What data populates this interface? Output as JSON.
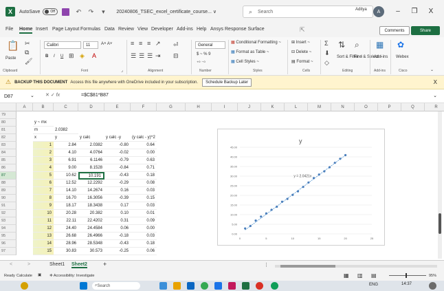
{
  "titlebar": {
    "autosave_label": "AutoSave",
    "autosave_state": "Off",
    "filename": "20240806_TSEC_excel_certificate_course... ∨",
    "search_placeholder": "Search",
    "user_name": "Aditya",
    "avatar_initial": "A",
    "minimize": "–",
    "restore": "❐",
    "close": "X"
  },
  "menu": {
    "items": [
      "File",
      "Home",
      "Insert",
      "Page Layout",
      "Formulas",
      "Data",
      "Review",
      "View",
      "Developer",
      "Add-ins",
      "Help",
      "Ansys Response Surface"
    ],
    "active": "Home",
    "comments_label": "Comments",
    "share_label": "Share"
  },
  "ribbon": {
    "groups": [
      "Clipboard",
      "Font",
      "Alignment",
      "Number",
      "Styles",
      "Cells",
      "Editing",
      "Add-ins",
      "Cisco"
    ],
    "paste_label": "Paste",
    "font_name": "Calibri",
    "font_size": "11",
    "number_format": "General",
    "styles": [
      "Conditional Formatting ~",
      "Format as Table ~",
      "Cell Styles ~"
    ],
    "cells": [
      "Insert ~",
      "Delete ~",
      "Format ~"
    ],
    "editing": [
      "Sort & Filter ~",
      "Find & Select ~"
    ],
    "addins_label": "Add-ins",
    "webex_label": "Webex"
  },
  "notification": {
    "title": "BACKUP THIS DOCUMENT",
    "message": "Access this file anywhere with OneDrive included in your subscription.",
    "button": "Schedule Backup Later",
    "close": "X"
  },
  "formula_bar": {
    "name_box": "D87",
    "fx": "fx",
    "formula": "=$C$81*B87"
  },
  "grid": {
    "columns": [
      "A",
      "B",
      "C",
      "D",
      "E",
      "F",
      "G",
      "H",
      "I",
      "J",
      "K",
      "L",
      "M",
      "N",
      "O",
      "P",
      "Q",
      "R"
    ],
    "rows": [
      "79",
      "80",
      "81",
      "82",
      "83",
      "84",
      "85",
      "86",
      "87",
      "88",
      "89",
      "90",
      "91",
      "92",
      "93",
      "94",
      "95",
      "96",
      "97"
    ],
    "selected_row": "87",
    "label_y_mx": "y ~ mx",
    "label_m": "m",
    "m_value": "2.0382",
    "headers": [
      "x",
      "y",
      "y calc",
      "y calc -y",
      "(y calc - y)^2"
    ],
    "data": [
      [
        "1",
        "2.84",
        "2.0382",
        "-0.80",
        "0.64"
      ],
      [
        "2",
        "4.10",
        "4.0764",
        "-0.02",
        "0.00"
      ],
      [
        "3",
        "6.91",
        "6.1146",
        "-0.79",
        "0.63"
      ],
      [
        "4",
        "9.00",
        "8.1528",
        "-0.84",
        "0.71"
      ],
      [
        "5",
        "10.62",
        "10.191",
        "-0.43",
        "0.18"
      ],
      [
        "6",
        "12.52",
        "12.2292",
        "-0.29",
        "0.08"
      ],
      [
        "7",
        "14.10",
        "14.2674",
        "0.16",
        "0.03"
      ],
      [
        "8",
        "16.70",
        "16.3056",
        "-0.39",
        "0.15"
      ],
      [
        "9",
        "18.17",
        "18.3438",
        "0.17",
        "0.03"
      ],
      [
        "10",
        "20.28",
        "20.382",
        "0.10",
        "0.01"
      ],
      [
        "11",
        "22.11",
        "22.4202",
        "0.31",
        "0.09"
      ],
      [
        "12",
        "24.40",
        "24.4584",
        "0.06",
        "0.00"
      ],
      [
        "13",
        "26.68",
        "26.4966",
        "-0.18",
        "0.03"
      ],
      [
        "14",
        "28.96",
        "28.5348",
        "-0.43",
        "0.18"
      ],
      [
        "15",
        "30.83",
        "30.573",
        "-0.25",
        "0.06"
      ]
    ]
  },
  "chart_data": {
    "type": "scatter",
    "title": "y",
    "annotation": "y = 2.0421x",
    "x": [
      1,
      2,
      3,
      4,
      5,
      6,
      7,
      8,
      9,
      10,
      11,
      12,
      13,
      14,
      15,
      16,
      17,
      18,
      19,
      20
    ],
    "y": [
      2.84,
      4.1,
      6.91,
      9.0,
      10.62,
      12.52,
      14.1,
      16.7,
      18.17,
      20.28,
      22.11,
      24.4,
      26.68,
      28.96,
      30.83,
      32.5,
      34.6,
      36.9,
      39.0,
      40.9
    ],
    "trendline_slope": 2.0421,
    "xlim": [
      0,
      25
    ],
    "ylim": [
      0,
      45
    ],
    "xticks": [
      "0",
      "5",
      "10",
      "15",
      "20",
      "25"
    ],
    "yticks": [
      "0.00",
      "5.00",
      "10.00",
      "15.00",
      "20.00",
      "25.00",
      "30.00",
      "35.00",
      "40.00",
      "45.00"
    ],
    "grid": true,
    "marker_color": "#4a7ebb"
  },
  "sheets": {
    "tabs": [
      "Sheet1",
      "Sheet2"
    ],
    "active": "Sheet2",
    "add": "+"
  },
  "status": {
    "ready": "Ready",
    "calculate": "Calculate",
    "accessibility": "Accessibility: Investigate",
    "zoom": "95%"
  },
  "taskbar": {
    "search": "Search",
    "lang": "ENG",
    "time": "14:37"
  }
}
